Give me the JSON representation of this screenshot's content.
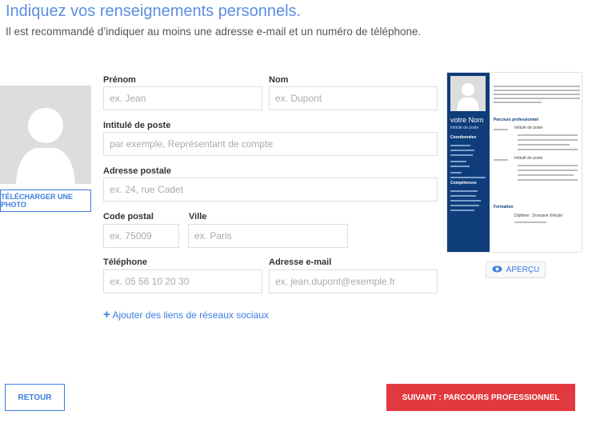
{
  "header": {
    "title": "Indiquez vos renseignements personnels.",
    "subtitle": "Il est recommandé d’indiquer au moins une adresse e-mail et un numéro de téléphone."
  },
  "photo": {
    "upload_label": "TÉLÉCHARGER UNE PHOTO"
  },
  "form": {
    "first_name": {
      "label": "Prénom",
      "placeholder": "ex. Jean"
    },
    "last_name": {
      "label": "Nom",
      "placeholder": "ex. Dupont"
    },
    "job_title": {
      "label": "Intitulé de poste",
      "placeholder": "par exemple, Représentant de compte"
    },
    "address": {
      "label": "Adresse postale",
      "placeholder": "ex. 24, rue Cadet"
    },
    "postal_code": {
      "label": "Code postal",
      "placeholder": "ex. 75009"
    },
    "city": {
      "label": "Ville",
      "placeholder": "ex. Paris"
    },
    "phone": {
      "label": "Téléphone",
      "placeholder": "ex. 05 56 10 20 30"
    },
    "email": {
      "label": "Adresse e-mail",
      "placeholder": "ex. jean.dupont@exemple.fr"
    },
    "add_social": "Ajouter des liens de réseaux sociaux"
  },
  "preview": {
    "name": "votre Nom",
    "job": "Intitulé de poste",
    "contact": "Coordonnées",
    "skills": "Compétences",
    "experience": "Parcours professionnel",
    "job1": "Intitulé de poste",
    "job2": "Intitulé de poste",
    "education": "Formation",
    "degree": "Diplôme : Domaine d'étude",
    "side_color": "#0e3d7a",
    "preview_label": "APERÇU"
  },
  "footer": {
    "back": "RETOUR",
    "next": "SUIVANT : PARCOURS PROFESSIONNEL",
    "next_color": "#e2393f",
    "accent": "#3a7fe0"
  }
}
